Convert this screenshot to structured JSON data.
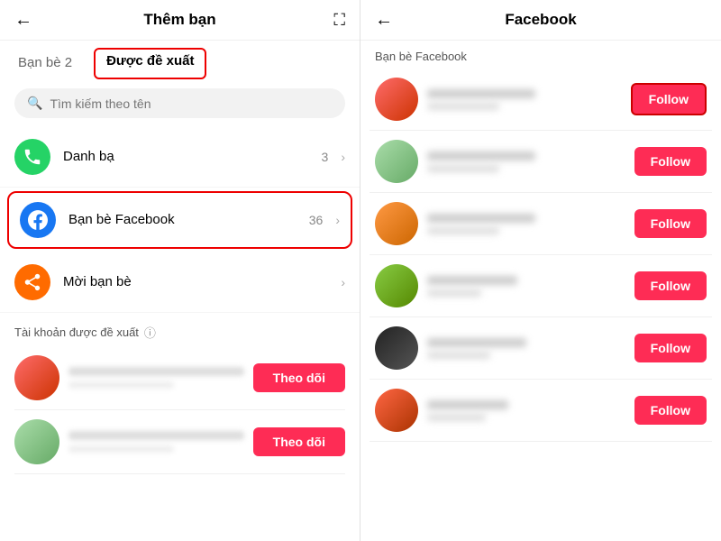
{
  "left": {
    "header": {
      "title": "Thêm bạn",
      "back_arrow": "←",
      "expand_icon": "⛶"
    },
    "tabs": [
      {
        "id": "friends",
        "label": "Bạn bè 2",
        "active": false
      },
      {
        "id": "suggested",
        "label": "Được đề xuất",
        "active": true
      }
    ],
    "search": {
      "placeholder": "Tìm kiếm theo tên"
    },
    "menu_items": [
      {
        "id": "contacts",
        "label": "Danh bạ",
        "count": "3",
        "icon": "phone",
        "icon_color": "green"
      },
      {
        "id": "facebook",
        "label": "Bạn bè Facebook",
        "count": "36",
        "icon": "fb",
        "icon_color": "blue",
        "highlighted": true
      },
      {
        "id": "invite",
        "label": "Mời bạn bè",
        "count": "",
        "icon": "share",
        "icon_color": "orange"
      }
    ],
    "suggested_section": {
      "title": "Tài khoản được đề xuất",
      "items": [
        {
          "id": 1,
          "follow_label": "Theo dõi"
        },
        {
          "id": 2,
          "follow_label": "Theo dõi"
        }
      ]
    }
  },
  "right": {
    "header": {
      "title": "Facebook",
      "back_arrow": "←"
    },
    "section_title": "Bạn bè Facebook",
    "friends": [
      {
        "id": 1,
        "follow_label": "Follow",
        "highlighted": true
      },
      {
        "id": 2,
        "follow_label": "Follow",
        "highlighted": false
      },
      {
        "id": 3,
        "follow_label": "Follow",
        "highlighted": false
      },
      {
        "id": 4,
        "follow_label": "Follow",
        "highlighted": false
      },
      {
        "id": 5,
        "follow_label": "Follow",
        "highlighted": false
      },
      {
        "id": 6,
        "follow_label": "Follow",
        "highlighted": false
      }
    ]
  }
}
